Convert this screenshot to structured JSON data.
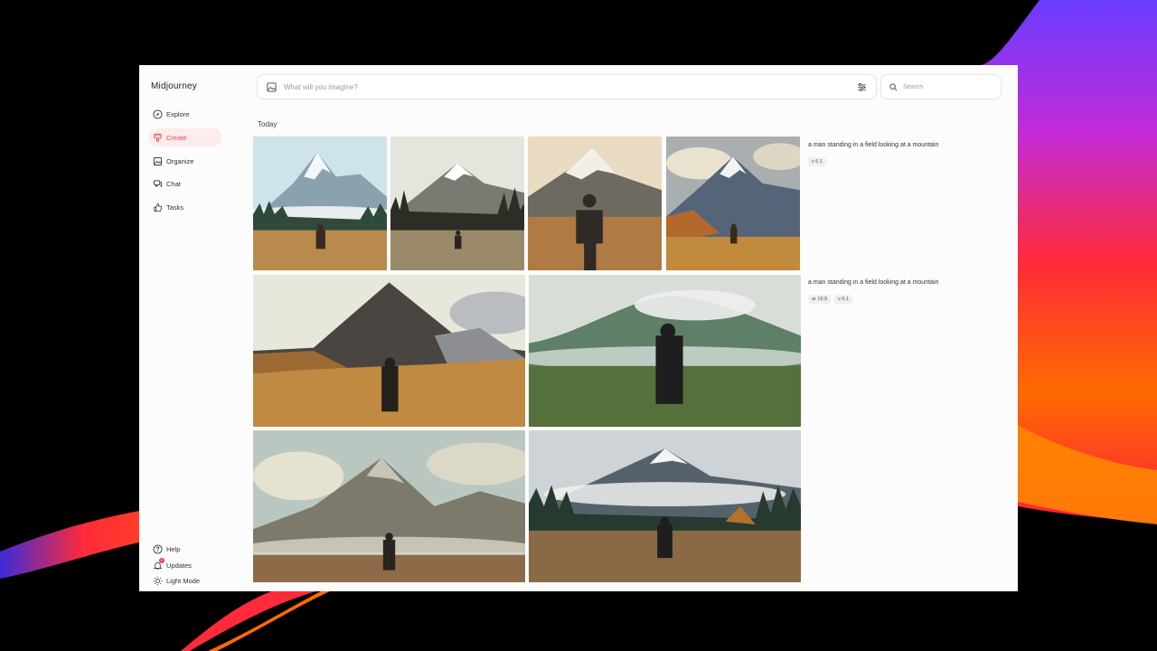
{
  "app": {
    "title": "Midjourney"
  },
  "sidebar": {
    "items": [
      {
        "label": "Explore",
        "icon": "compass-icon"
      },
      {
        "label": "Create",
        "icon": "brush-icon",
        "active": true
      },
      {
        "label": "Organize",
        "icon": "image-icon"
      },
      {
        "label": "Chat",
        "icon": "chat-icon"
      },
      {
        "label": "Tasks",
        "icon": "thumbs-up-icon"
      }
    ],
    "footer": [
      {
        "label": "Help",
        "icon": "help-icon"
      },
      {
        "label": "Updates",
        "icon": "bell-icon",
        "badge": "2"
      },
      {
        "label": "Light Mode",
        "icon": "sun-icon"
      }
    ]
  },
  "prompt": {
    "placeholder": "What will you imagine?"
  },
  "search": {
    "placeholder": "Search"
  },
  "feed": {
    "section": "Today",
    "jobs": [
      {
        "prompt": "a man standing in a field looking at a mountain",
        "tags": [
          "v 6.1"
        ]
      },
      {
        "prompt": "a man standing in a field looking at a mountain",
        "tags": [
          "ar 16:9",
          "v 6.1"
        ]
      }
    ]
  },
  "colors": {
    "accent": "#e0474c",
    "active_bg": "#fdecec",
    "window_bg": "#fcfcfc"
  }
}
